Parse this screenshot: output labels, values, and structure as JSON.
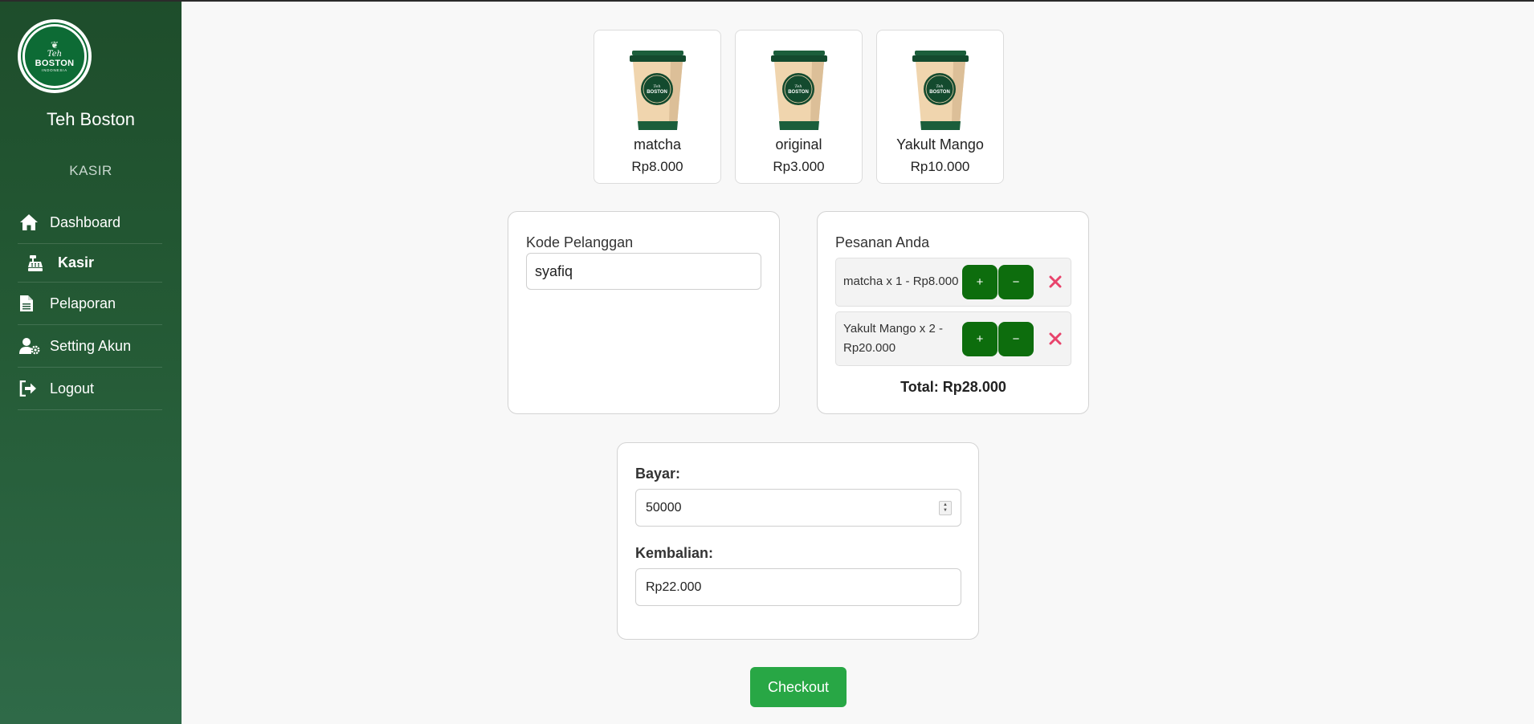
{
  "sidebar": {
    "logo": {
      "teh": "Teh",
      "boston": "BOSTON",
      "indonesia": "INDONESIA"
    },
    "brand": "Teh Boston",
    "role": "KASIR",
    "items": [
      {
        "label": "Dashboard",
        "icon": "home-icon"
      },
      {
        "label": "Kasir",
        "icon": "cash-register-icon",
        "active": true
      },
      {
        "label": "Pelaporan",
        "icon": "file-icon"
      },
      {
        "label": "Setting Akun",
        "icon": "user-gear-icon"
      },
      {
        "label": "Logout",
        "icon": "logout-icon"
      }
    ]
  },
  "products": [
    {
      "name": "matcha",
      "price": "Rp8.000"
    },
    {
      "name": "original",
      "price": "Rp3.000"
    },
    {
      "name": "Yakult Mango",
      "price": "Rp10.000"
    }
  ],
  "cup_logo": {
    "teh": "Teh",
    "boston": "BOSTON"
  },
  "customer": {
    "label": "Kode Pelanggan",
    "value": "syafiq"
  },
  "order": {
    "title": "Pesanan Anda",
    "items": [
      {
        "text": "matcha x 1 - Rp8.000"
      },
      {
        "text": "Yakult Mango x 2 - Rp20.000"
      }
    ],
    "plus_label": "+",
    "minus_label": "−",
    "total": "Total: Rp28.000"
  },
  "payment": {
    "bayar_label": "Bayar:",
    "bayar_value": "50000",
    "kembalian_label": "Kembalian:",
    "kembalian_value": "Rp22.000"
  },
  "checkout_label": "Checkout",
  "colors": {
    "sidebar_top": "#1e4d2b",
    "sidebar_bottom": "#2f6a48",
    "button_green": "#0d6d0d",
    "checkout_green": "#28a745",
    "remove_red": "#e8436b"
  }
}
